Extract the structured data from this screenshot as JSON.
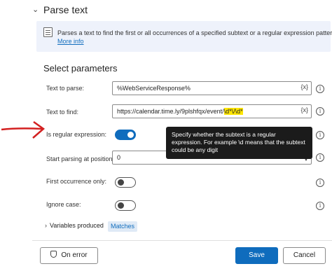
{
  "header": {
    "title": "Parse text",
    "collapse_icon": "chevron-down-icon"
  },
  "info": {
    "description": "Parses a text to find the first or all occurrences of a specified subtext or a regular expression pattern",
    "more_link": "More info",
    "icon": "document-icon"
  },
  "section_title": "Select parameters",
  "params": {
    "text_to_parse": {
      "label": "Text to parse:",
      "value": "%WebServiceResponse%",
      "var_button": "{x}"
    },
    "text_to_find": {
      "label": "Text to find:",
      "value_prefix": "https://calendar.time.ly/9plshfqx/event/",
      "value_highlight": "\\d*\\/\\d*",
      "var_button": "{x}"
    },
    "is_regex": {
      "label": "Is regular expression:",
      "on": true
    },
    "start_position": {
      "label": "Start parsing at position:",
      "value": "0"
    },
    "first_occurrence": {
      "label": "First occurrence only:",
      "on": false
    },
    "ignore_case": {
      "label": "Ignore case:",
      "on": false
    }
  },
  "tooltip": "Specify whether the subtext is a regular expression. For example \\d means that the subtext could be any digit",
  "variables_produced": {
    "label": "Variables produced",
    "badge": "Matches"
  },
  "buttons": {
    "on_error": "On error",
    "save": "Save",
    "cancel": "Cancel"
  },
  "colors": {
    "accent": "#0f6cbd",
    "highlight": "#ffe600",
    "annotation_arrow": "#d32020"
  }
}
